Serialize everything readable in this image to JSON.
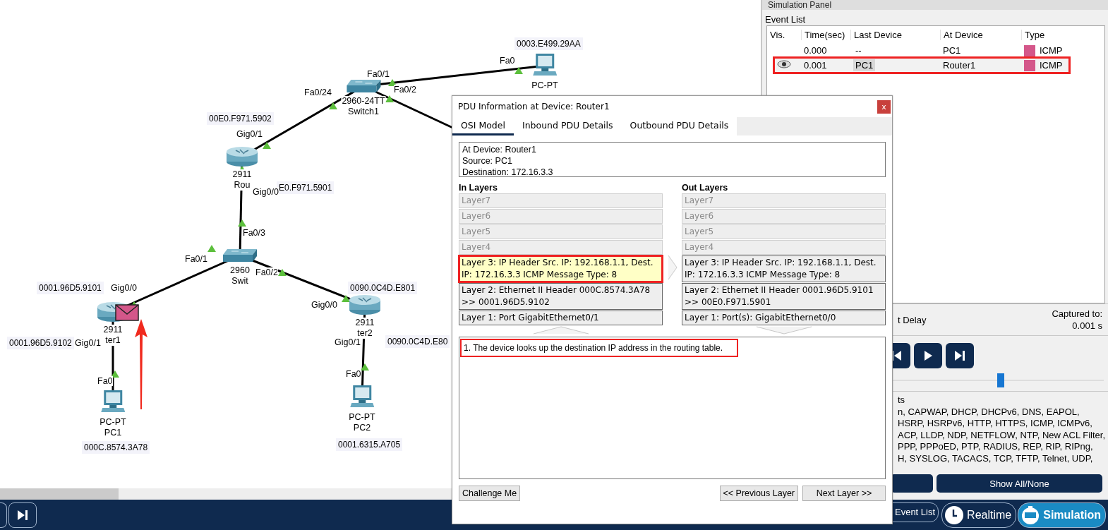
{
  "canvas": {
    "devices": [
      {
        "kind": "pc",
        "labels": [
          "PC-PT"
        ],
        "pdu": false
      },
      {
        "kind": "switch",
        "labels": [
          "2960-24TT",
          "Switch1"
        ],
        "pdu": false
      },
      {
        "kind": "router",
        "labels": [
          "2911",
          "Rou"
        ],
        "pdu": false
      },
      {
        "kind": "switch",
        "labels": [
          "2960",
          "Swit"
        ],
        "pdu": false
      },
      {
        "kind": "router",
        "labels": [
          "2911",
          "ter1"
        ],
        "pdu": true
      },
      {
        "kind": "router",
        "labels": [
          "2911",
          "ter2"
        ],
        "pdu": false
      },
      {
        "kind": "pc",
        "labels": [
          "PC-PT",
          "PC1"
        ],
        "pdu": false
      },
      {
        "kind": "pc",
        "labels": [
          "PC-PT",
          "PC2"
        ],
        "pdu": false
      }
    ],
    "address_labels": [
      "0003.E499.29AA",
      "00E0.F971.5902",
      "E0.F971.5901",
      "0001.96D5.9101",
      "0001.96D5.9102",
      "0090.0C4D.E801",
      "0090.0C4D.E80",
      "000C.8574.3A78",
      "0001.6315.A705"
    ],
    "port_labels": [
      "Fa0",
      "Fa0/1",
      "Fa0/2",
      "Fa0/24",
      "Gig0/1",
      "Gig0/0",
      "Fa0/3",
      "Fa0/1",
      "Fa0/2",
      "Gig0/0",
      "Gig0/1",
      "Fa0",
      "Gig0/0",
      "Gig0/1",
      "Fa0"
    ]
  },
  "simulation_panel": {
    "title": "Simulation Panel",
    "event_list_label": "Event List",
    "columns": [
      "Vis.",
      "Time(sec)",
      "Last Device",
      "At Device",
      "Type"
    ],
    "events": [
      {
        "eye": false,
        "time": "0.000",
        "last_device": "--",
        "at_device": "PC1",
        "type": "ICMP",
        "color": "#d4578a",
        "selected": false,
        "highlighted": false
      },
      {
        "eye": true,
        "time": "0.001",
        "last_device": "PC1",
        "at_device": "Router1",
        "type": "ICMP",
        "color": "#d4578a",
        "selected": true,
        "highlighted": true
      }
    ],
    "delay_fragment": "t Delay",
    "captured_label": "Captured to:",
    "captured_value": "0.001 s",
    "playback": {
      "level": 0.69
    },
    "filter_heading_fragment": "ts",
    "filter_lines": [
      "n, CAPWAP, DHCP, DHCPv6, DNS, EAPOL,",
      "HSRP, HSRPv6, HTTP, HTTPS, ICMP, ICMPv6,",
      "ACP, LLDP, NDP, NETFLOW, NTP, New ACL Filter,",
      "PPP, PPPoED, PTP, RADIUS, REP, RIP, RIPng,",
      "H, SYSLOG, TACACS, TCP, TFTP, Telnet, UDP,"
    ],
    "show_all_button": "Show All/None"
  },
  "dialog": {
    "title": "PDU Information at Device: Router1",
    "close_glyph": "x",
    "tabs": [
      {
        "label": "OSI Model",
        "selected": true
      },
      {
        "label": "Inbound PDU Details",
        "selected": false
      },
      {
        "label": "Outbound PDU Details",
        "selected": false
      }
    ],
    "info_lines": [
      "At Device: Router1",
      "Source: PC1",
      "Destination: 172.16.3.3"
    ],
    "in_heading": "In Layers",
    "out_heading": "Out Layers",
    "in_layers": [
      {
        "text": "Layer7",
        "disabled": true,
        "selected": false,
        "highlighted": false
      },
      {
        "text": "Layer6",
        "disabled": true,
        "selected": false,
        "highlighted": false
      },
      {
        "text": "Layer5",
        "disabled": true,
        "selected": false,
        "highlighted": false
      },
      {
        "text": "Layer4",
        "disabled": true,
        "selected": false,
        "highlighted": false
      },
      {
        "text": "Layer 3: IP Header Src. IP: 192.168.1.1, Dest. IP: 172.16.3.3 ICMP Message Type: 8",
        "disabled": false,
        "selected": true,
        "highlighted": true
      },
      {
        "text": "Layer 2: Ethernet II Header 000C.8574.3A78 >> 0001.96D5.9102",
        "disabled": false,
        "selected": false,
        "highlighted": false
      },
      {
        "text": "Layer 1: Port GigabitEthernet0/1",
        "disabled": false,
        "selected": false,
        "highlighted": false
      }
    ],
    "out_layers": [
      {
        "text": "Layer7",
        "disabled": true,
        "selected": false,
        "highlighted": false
      },
      {
        "text": "Layer6",
        "disabled": true,
        "selected": false,
        "highlighted": false
      },
      {
        "text": "Layer5",
        "disabled": true,
        "selected": false,
        "highlighted": false
      },
      {
        "text": "Layer4",
        "disabled": true,
        "selected": false,
        "highlighted": false
      },
      {
        "text": "Layer 3: IP Header Src. IP: 192.168.1.1, Dest. IP: 172.16.3.3 ICMP Message Type: 8",
        "disabled": false,
        "selected": false,
        "highlighted": false
      },
      {
        "text": "Layer 2: Ethernet II Header 0001.96D5.9101 >> 00E0.F971.5901",
        "disabled": false,
        "selected": false,
        "highlighted": false
      },
      {
        "text": "Layer 1: Port(s): GigabitEthernet0/0",
        "disabled": false,
        "selected": false,
        "highlighted": false
      }
    ],
    "steps": [
      {
        "text": "1. The device looks up the destination IP address in the routing table.",
        "highlighted": true
      }
    ],
    "challenge_button": "Challenge Me",
    "previous_button": "<< Previous Layer",
    "next_button": "Next Layer >>"
  },
  "bottom_bar": {
    "mode_buttons": [
      {
        "kind": "event_list",
        "label": "Event List",
        "selected": false
      },
      {
        "kind": "realtime",
        "label": "Realtime",
        "selected": false
      },
      {
        "kind": "simulation",
        "label": "Simulation",
        "selected": true
      }
    ]
  }
}
